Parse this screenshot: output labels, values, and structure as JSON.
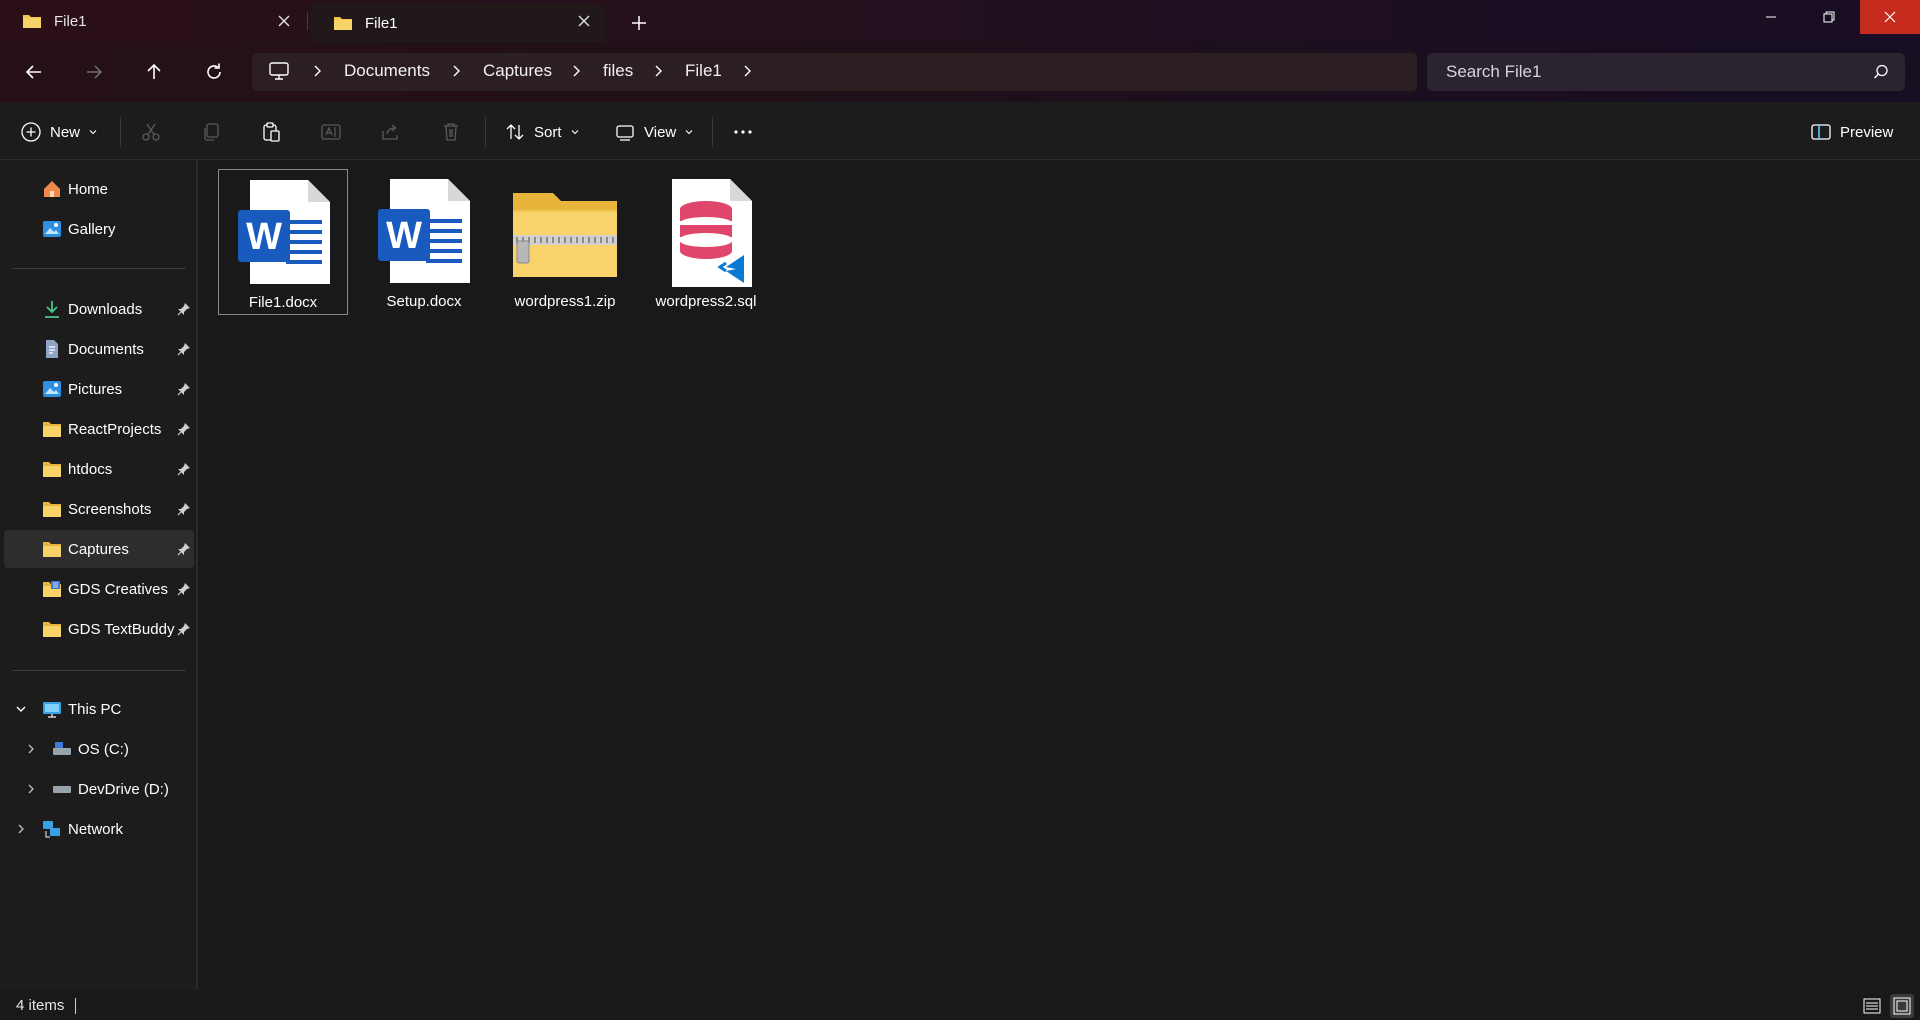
{
  "tabs": [
    {
      "label": "File1",
      "active": false
    },
    {
      "label": "File1",
      "active": true
    }
  ],
  "breadcrumbs": [
    "Documents",
    "Captures",
    "files",
    "File1"
  ],
  "search": {
    "placeholder": "Search File1"
  },
  "toolbar": {
    "new_label": "New",
    "sort_label": "Sort",
    "view_label": "View",
    "preview_label": "Preview"
  },
  "sidebar": {
    "quick": [
      {
        "label": "Home",
        "icon": "home-icon"
      },
      {
        "label": "Gallery",
        "icon": "gallery-icon"
      }
    ],
    "pinned": [
      {
        "label": "Downloads",
        "icon": "download-icon"
      },
      {
        "label": "Documents",
        "icon": "documents-icon"
      },
      {
        "label": "Pictures",
        "icon": "pictures-icon"
      },
      {
        "label": "ReactProjects",
        "icon": "folder-icon"
      },
      {
        "label": "htdocs",
        "icon": "folder-icon"
      },
      {
        "label": "Screenshots",
        "icon": "folder-icon"
      },
      {
        "label": "Captures",
        "icon": "folder-icon",
        "selected": true
      },
      {
        "label": "GDS Creatives",
        "icon": "folder-icon"
      },
      {
        "label": "GDS TextBuddy",
        "icon": "folder-icon"
      }
    ],
    "this_pc": "This PC",
    "drives": [
      {
        "label": "OS (C:)",
        "icon": "drive-c-icon"
      },
      {
        "label": "DevDrive (D:)",
        "icon": "drive-d-icon"
      }
    ],
    "network": "Network"
  },
  "files": [
    {
      "name": "File1.docx",
      "type": "word",
      "selected": true
    },
    {
      "name": "Setup.docx",
      "type": "word"
    },
    {
      "name": "wordpress1.zip",
      "type": "zip"
    },
    {
      "name": "wordpress2.sql",
      "type": "sql"
    }
  ],
  "status": {
    "items": "4 items"
  },
  "colors": {
    "accent": "#60cdff",
    "folder": "#f4c44e",
    "word_blue": "#185abd",
    "sql_pink": "#e0456b",
    "close_red": "#c42b1c"
  }
}
